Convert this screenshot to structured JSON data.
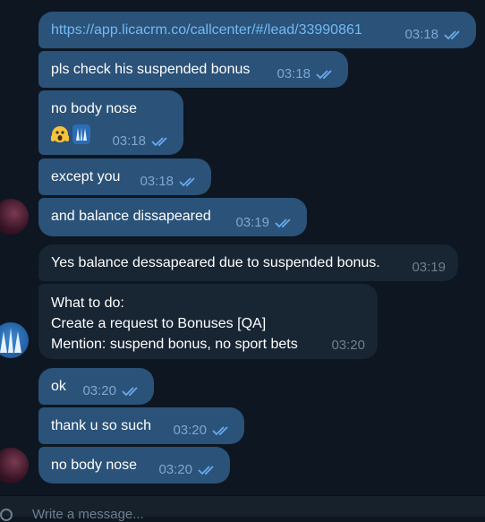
{
  "messages": [
    {
      "text": "https://app.licacrm.co/callcenter/#/lead/33990861",
      "time": "03:18"
    },
    {
      "text": "pls check his suspended bonus",
      "time": "03:18"
    },
    {
      "text": "no body nose",
      "time": "03:18"
    },
    {
      "text": "except you",
      "time": "03:18"
    },
    {
      "text": "and balance dissapeared",
      "time": "03:19"
    },
    {
      "text": "Yes balance dessapeared due to suspended bonus.",
      "time": "03:19"
    },
    {
      "text": "What to do:\nCreate a request to Bonuses [QA]\nMention: suspend bonus, no sport bets",
      "time": "03:20"
    },
    {
      "text": "ok",
      "time": "03:20"
    },
    {
      "text": "thank u so such",
      "time": "03:20"
    },
    {
      "text": "no body nose",
      "time": "03:20"
    }
  ],
  "composer": {
    "placeholder": "Write a message..."
  },
  "colors": {
    "background": "#0e1621",
    "outgoing_bubble": "#2b5278",
    "incoming_bubble": "#182533",
    "link": "#71baf7",
    "read_ticks": "#68abf0"
  },
  "icons": [
    "double-check-icon",
    "avatar-self",
    "avatar-contact",
    "scream-emoji-icon",
    "custom-emoji-icon",
    "attach-icon"
  ]
}
